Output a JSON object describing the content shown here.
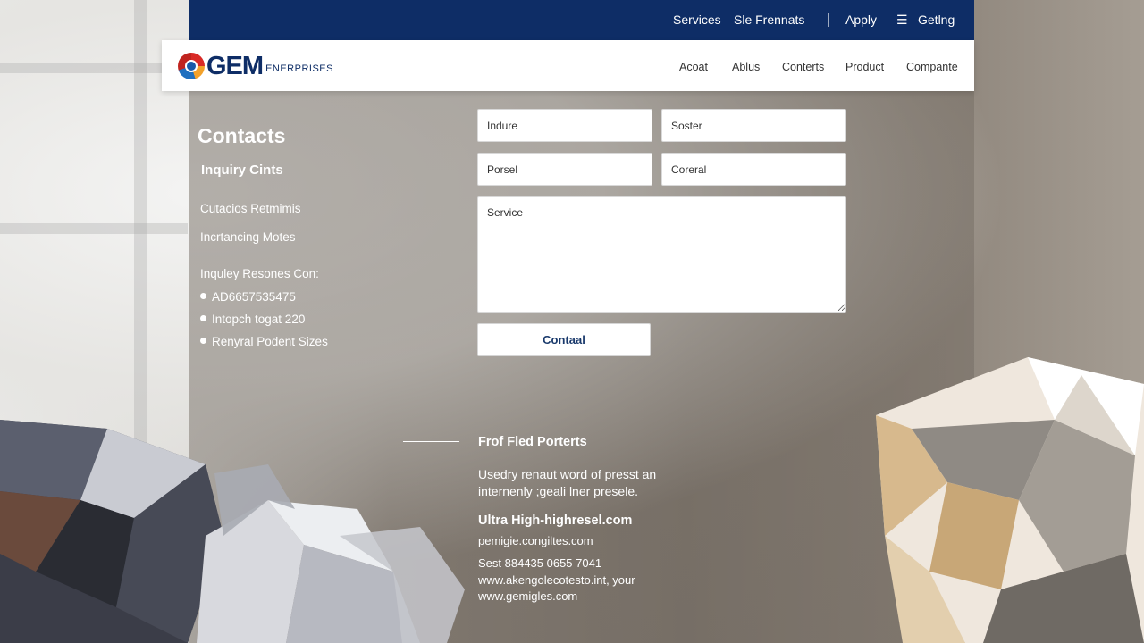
{
  "topbar": {
    "links": [
      "Services",
      "Sle Frennats",
      "Apply",
      "Getlng"
    ],
    "menu_icon": "hamburger-icon"
  },
  "navbar": {
    "logo_word": "GEM",
    "logo_sub": "ENERPRISES",
    "links": [
      "Acoat",
      "Ablus",
      "Conterts",
      "Product",
      "Compante"
    ]
  },
  "sidebar": {
    "title": "Contacts",
    "subtitle": "Inquiry Cints",
    "items": [
      "Cutacios Retmimis",
      "Incrtancing Motes"
    ],
    "list_heading": "Inquley Resones Con:",
    "bullets": [
      "AD6657535475",
      "Intopch togat 220",
      "Renyral Podent Sizes"
    ]
  },
  "form": {
    "field1_placeholder": "Indure",
    "field2_placeholder": "Soster",
    "field3_placeholder": "Porsel",
    "field4_placeholder": "Coreral",
    "message_placeholder": "Service",
    "submit_label": "Contaal"
  },
  "footer": {
    "title": "Frof Fled Porterts",
    "text": "Usedry renaut word of presst an internenly ;geali lner presele.",
    "strong": "Ultra High-highresel.com",
    "lines": [
      "pemigie.congiltes.com",
      "Sest 884435 0655 7041",
      "www.akengolecotesto.int, your",
      "www.gemigles.com"
    ]
  }
}
